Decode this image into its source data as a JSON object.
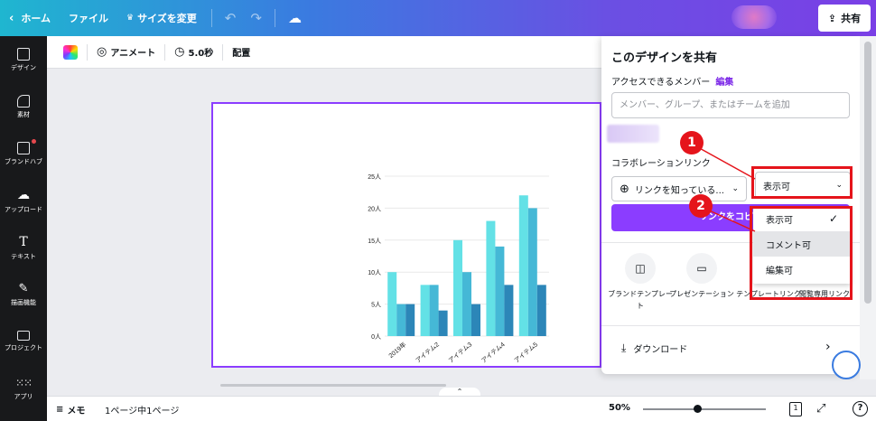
{
  "topbar": {
    "home": "ホーム",
    "file": "ファイル",
    "resize": "サイズを変更",
    "share": "共有"
  },
  "sidebar": {
    "items": [
      {
        "label": "デザイン",
        "icon": "design-icon"
      },
      {
        "label": "素材",
        "icon": "elements-icon"
      },
      {
        "label": "ブランドハブ",
        "icon": "brand-hub-icon"
      },
      {
        "label": "アップロード",
        "icon": "upload-icon"
      },
      {
        "label": "テキスト",
        "icon": "text-icon"
      },
      {
        "label": "描画機能",
        "icon": "draw-icon"
      },
      {
        "label": "プロジェクト",
        "icon": "folder-icon"
      },
      {
        "label": "アプリ",
        "icon": "apps-icon"
      }
    ]
  },
  "context_bar": {
    "animate": "アニメート",
    "duration": "5.0秒",
    "position": "配置"
  },
  "chart_data": {
    "type": "bar",
    "categories": [
      "2019年",
      "アイテム2",
      "アイテム3",
      "アイテム4",
      "アイテム5"
    ],
    "series": [
      {
        "values": [
          10,
          8,
          15,
          18,
          22
        ],
        "color": "#63e1e6"
      },
      {
        "values": [
          5,
          8,
          10,
          14,
          20
        ],
        "color": "#45b8d6"
      },
      {
        "values": [
          5,
          4,
          5,
          8,
          8
        ],
        "color": "#2c86b8"
      }
    ],
    "yticks": [
      "0人",
      "5人",
      "10人",
      "15人",
      "20人",
      "25人"
    ],
    "ylim": [
      0,
      25
    ],
    "grid": true
  },
  "bottombar": {
    "memo": "メモ",
    "pages": "1ページ中1ページ",
    "zoom": "50%",
    "page_count": "1",
    "help": "?"
  },
  "share_panel": {
    "title": "このデザインを共有",
    "access_label": "アクセスできるメンバー",
    "edit_link": "編集",
    "input_placeholder": "メンバー、グループ、またはチームを追加",
    "collab_label": "コラボレーションリンク",
    "link_scope": "リンクを知っている...",
    "permission": "表示可",
    "copy_button": "リンクをコピー",
    "options": [
      {
        "label": "ブランドテンプレート",
        "icon": "brand-template-icon"
      },
      {
        "label": "プレゼンテーション",
        "icon": "presentation-icon"
      },
      {
        "label": "テンプレートリンク",
        "icon": "template-link-icon"
      },
      {
        "label": "閲覧専用リンク",
        "icon": "view-only-link-icon"
      }
    ],
    "download": "ダウンロード"
  },
  "dropdown": {
    "items": [
      "表示可",
      "コメント可",
      "編集可"
    ],
    "selected": "表示可",
    "highlighted": "コメント可"
  },
  "annotations": {
    "step1": "1",
    "step2": "2",
    "color": "#e5141b"
  }
}
